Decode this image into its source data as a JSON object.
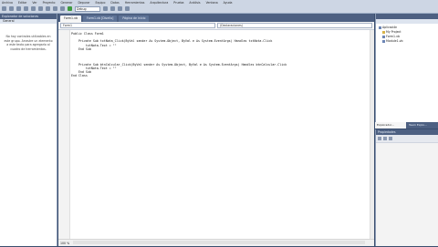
{
  "menu": [
    "Archivo",
    "Editar",
    "Ver",
    "Proyecto",
    "Generar",
    "Depurar",
    "Equipo",
    "Datos",
    "Herramientas",
    "Arquitectura",
    "Prueba",
    "Análisis",
    "Ventana",
    "Ayuda"
  ],
  "toolbar": {
    "config_value": "Debug"
  },
  "left_panel": {
    "title": "Explorador de soluciones",
    "subtitle": "General",
    "message": "No hay controles utilizables en este grupo. Arrastre un elemento a este texto para agregarlo al cuadro de herramientas."
  },
  "editor": {
    "tabs": [
      {
        "label": "Form1.vb",
        "active": true
      },
      {
        "label": "Form1.vb [Diseño]",
        "active": false
      },
      {
        "label": "Página de inicio",
        "active": false
      }
    ],
    "left_combo": "Form1",
    "right_combo": "(Declaraciones)",
    "code_lines": [
      "Public Class Form1",
      "",
      "    Private Sub txtNota_Click(ByVal sender As System.Object, ByVal e As System.EventArgs) Handles txtNota.Click",
      "        txtNota.Text = \"\"",
      "    End Sub",
      "",
      "",
      "",
      "    Private Sub btnCalcular_Click(ByVal sender As System.Object, ByVal e As System.EventArgs) Handles btnCalcular.Click",
      "        txtNota.Text = \"\"",
      "    End Sub",
      "End Class"
    ],
    "zoom": "100 %"
  },
  "solution_explorer": {
    "items": [
      {
        "label": "Aplicación",
        "kind": "project"
      },
      {
        "label": "My Project",
        "kind": "folder"
      },
      {
        "label": "Form1.vb",
        "kind": "file"
      },
      {
        "label": "Module1.vb",
        "kind": "file"
      }
    ]
  },
  "right_tabs": [
    {
      "label": "Explorador...",
      "active": true
    },
    {
      "label": "Team Explo...",
      "active": false
    }
  ],
  "properties": {
    "title": "Propiedades"
  }
}
